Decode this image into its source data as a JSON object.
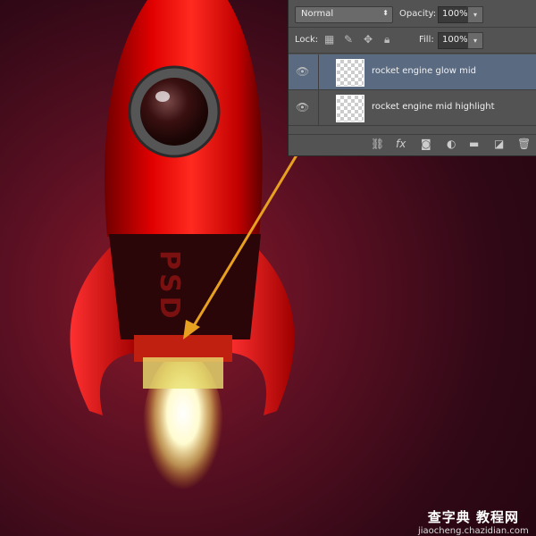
{
  "layers_panel": {
    "blend_mode": "Normal",
    "opacity_label": "Opacity:",
    "opacity_value": "100%",
    "lock_label": "Lock:",
    "fill_label": "Fill:",
    "fill_value": "100%",
    "layers": [
      {
        "name": "rocket engine glow mid",
        "visible": true,
        "selected": true
      },
      {
        "name": "rocket engine mid highlight",
        "visible": true,
        "selected": false
      }
    ],
    "footer_icons": [
      "link-icon",
      "fx-icon",
      "mask-icon",
      "adjustment-icon",
      "folder-icon",
      "new-layer-icon",
      "trash-icon"
    ],
    "fx_label": "fx"
  },
  "artwork": {
    "rocket_lettering": "PSD",
    "accent_color": "#e8a020"
  },
  "watermark": {
    "title": "查字典 教程网",
    "url": "jiaocheng.chazidian.com"
  }
}
